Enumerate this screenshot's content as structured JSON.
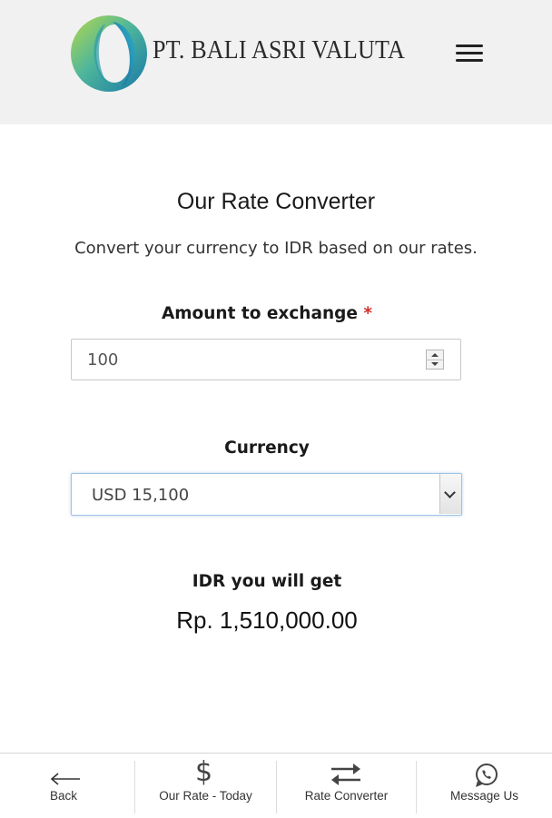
{
  "header": {
    "brand_name": "PT. BALI ASRI VALUTA",
    "logo_icon": "swirl-logo-icon",
    "menu_icon": "hamburger-menu-icon"
  },
  "main": {
    "title": "Our Rate Converter",
    "subtitle": "Convert your currency to IDR based on our rates.",
    "amount": {
      "label": "Amount to exchange",
      "required_mark": "*",
      "value": "100"
    },
    "currency": {
      "label": "Currency",
      "selected": "USD 15,100"
    },
    "result": {
      "label": "IDR you will get",
      "value": "Rp. 1,510,000.00"
    }
  },
  "bottom_nav": {
    "items": [
      {
        "label": "Back",
        "icon": "arrow-left-icon"
      },
      {
        "label": "Our Rate - Today",
        "icon": "dollar-icon"
      },
      {
        "label": "Rate Converter",
        "icon": "exchange-arrows-icon"
      },
      {
        "label": "Message Us",
        "icon": "whatsapp-icon"
      }
    ]
  },
  "colors": {
    "header_bg": "#f1f1f1",
    "required": "#d0312d",
    "focus_border": "#9ec3e6",
    "logo_teal": "#1aa0a8",
    "logo_green": "#8fc23f"
  }
}
